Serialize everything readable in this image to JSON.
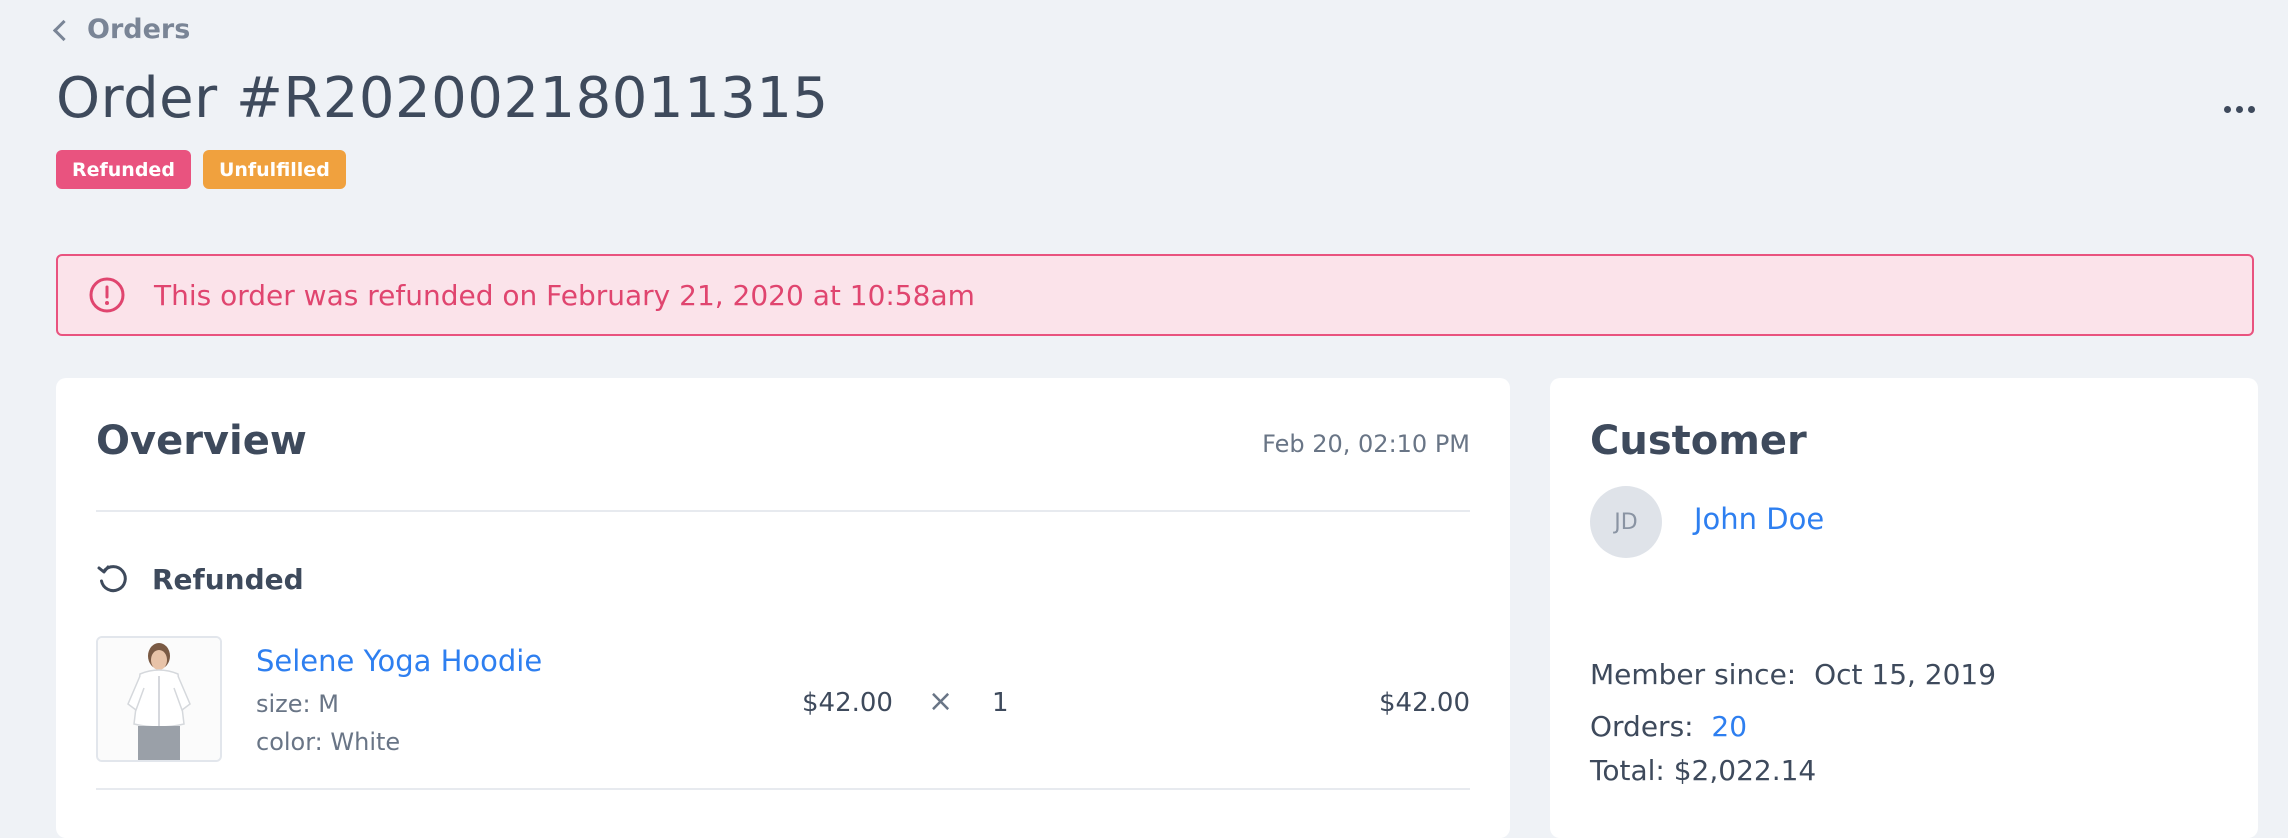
{
  "breadcrumb": {
    "label": "Orders"
  },
  "order": {
    "title": "Order #R20200218011315",
    "badges": [
      "Refunded",
      "Unfulfilled"
    ]
  },
  "alert": {
    "text": "This order was refunded on February 21, 2020 at 10:58am"
  },
  "overview": {
    "title": "Overview",
    "date": "Feb 20, 02:10 PM",
    "section_label": "Refunded",
    "item": {
      "name": "Selene Yoga Hoodie",
      "size": "size: M",
      "color": "color: White",
      "unit_price": "$42.00",
      "times": "×",
      "quantity": "1",
      "total": "$42.00"
    }
  },
  "customer": {
    "title": "Customer",
    "initials": "JD",
    "name": "John Doe",
    "member_label": "Member since:",
    "member_since": "Oct 15, 2019",
    "orders_label": "Orders:",
    "orders_count": "20",
    "total_label": "Total:",
    "total_value": "$2,022.14"
  },
  "colors": {
    "accent": "#2e7ff0",
    "refunded": "#e9537f",
    "unfulfilled": "#f0a13e",
    "background": "#eff2f6"
  }
}
